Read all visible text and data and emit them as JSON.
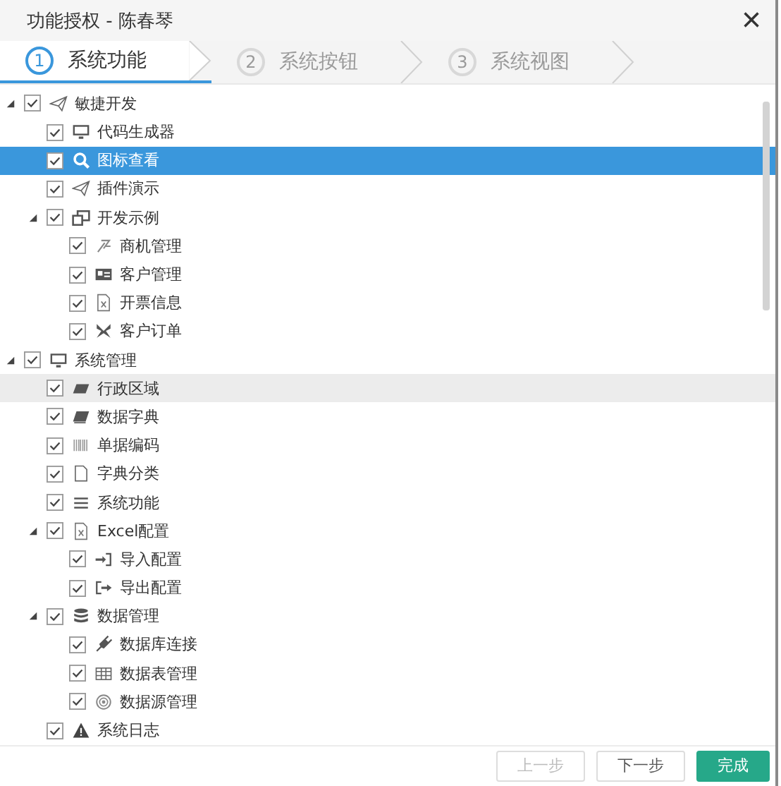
{
  "dialog": {
    "title": "功能授权 - 陈春琴",
    "close": "×"
  },
  "steps": [
    {
      "number": "1",
      "label": "系统功能",
      "selected": true
    },
    {
      "number": "2",
      "label": "系统按钮",
      "selected": false
    },
    {
      "number": "3",
      "label": "系统视图",
      "selected": false
    }
  ],
  "tree": [
    {
      "label": "敏捷开发",
      "checked": true,
      "selected": false,
      "hovered": false,
      "expanded": true,
      "children": [
        {
          "label": "代码生成器",
          "checked": true,
          "selected": false,
          "hovered": false
        },
        {
          "label": "图标查看",
          "checked": true,
          "selected": true,
          "hovered": false
        },
        {
          "label": "插件演示",
          "checked": true,
          "selected": false,
          "hovered": false
        },
        {
          "label": "开发示例",
          "checked": true,
          "selected": false,
          "hovered": false,
          "expanded": true,
          "children": [
            {
              "label": "商机管理",
              "checked": true,
              "selected": false,
              "hovered": false
            },
            {
              "label": "客户管理",
              "checked": true,
              "selected": false,
              "hovered": false
            },
            {
              "label": "开票信息",
              "checked": true,
              "selected": false,
              "hovered": false
            },
            {
              "label": "客户订单",
              "checked": true,
              "selected": false,
              "hovered": false
            }
          ]
        }
      ]
    },
    {
      "label": "系统管理",
      "checked": true,
      "selected": false,
      "hovered": false,
      "expanded": true,
      "children": [
        {
          "label": "行政区域",
          "checked": true,
          "selected": false,
          "hovered": true
        },
        {
          "label": "数据字典",
          "checked": true,
          "selected": false,
          "hovered": false
        },
        {
          "label": "单据编码",
          "checked": true,
          "selected": false,
          "hovered": false
        },
        {
          "label": "字典分类",
          "checked": true,
          "selected": false,
          "hovered": false
        },
        {
          "label": "系统功能",
          "checked": true,
          "selected": false,
          "hovered": false
        },
        {
          "label": "Excel配置",
          "checked": true,
          "selected": false,
          "hovered": false,
          "expanded": true,
          "children": [
            {
              "label": "导入配置",
              "checked": true,
              "selected": false,
              "hovered": false
            },
            {
              "label": "导出配置",
              "checked": true,
              "selected": false,
              "hovered": false
            }
          ]
        },
        {
          "label": "数据管理",
          "checked": true,
          "selected": false,
          "hovered": false,
          "expanded": true,
          "children": [
            {
              "label": "数据库连接",
              "checked": true,
              "selected": false,
              "hovered": false
            },
            {
              "label": "数据表管理",
              "checked": true,
              "selected": false,
              "hovered": false
            },
            {
              "label": "数据源管理",
              "checked": true,
              "selected": false,
              "hovered": false
            }
          ]
        },
        {
          "label": "系统日志",
          "checked": true,
          "selected": false,
          "hovered": false
        }
      ]
    }
  ],
  "buttons": [
    {
      "label": "上一步",
      "kind": "default",
      "disabled": true
    },
    {
      "label": "下一步",
      "kind": "default",
      "disabled": false
    },
    {
      "label": "完成",
      "kind": "primary",
      "disabled": false
    }
  ]
}
